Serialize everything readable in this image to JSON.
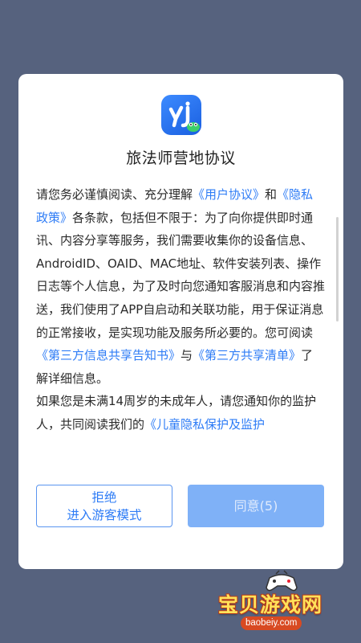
{
  "dialog": {
    "title": "旅法师营地协议",
    "paragraph1": [
      {
        "text": "请您务必谨慎阅读、充分理解",
        "link": false
      },
      {
        "text": "《用户协议》",
        "link": true
      },
      {
        "text": "和",
        "link": false
      },
      {
        "text": "《隐私政策》",
        "link": true
      },
      {
        "text": "各条款，包括但不限于：为了向你提供即时通讯、内容分享等服务，我们需要收集你的设备信息、AndroidID、OAID、MAC地址、软件安装列表、操作日志等个人信息，为了及时向您通知客服消息和内容推送，我们使用了APP自启动和关联功能，用于保证消息的正常接收，是实现功能及服务所必要的。您可阅读",
        "link": false
      },
      {
        "text": "《第三方信息共享告知书》",
        "link": true
      },
      {
        "text": "与",
        "link": false
      },
      {
        "text": "《第三方共享清单》",
        "link": true
      },
      {
        "text": "了解详细信息。",
        "link": false
      }
    ],
    "paragraph2": [
      {
        "text": "如果您是未满14周岁的未成年人，请您通知你的监护人，共同阅读我们的",
        "link": false
      },
      {
        "text": "《儿童隐私保护及监护",
        "link": true
      }
    ],
    "decline_line1": "拒绝",
    "decline_line2": "进入游客模式",
    "agree_label": "同意(5)"
  },
  "watermark": {
    "text": "宝贝游戏网",
    "url": "baobeiy.com"
  },
  "colors": {
    "background": "#56627e",
    "link": "#2e7cf6",
    "agree_button": "#7fb1f7"
  },
  "icons": {
    "app_logo": "yj-app-logo-icon",
    "mascot": "gamepad-mascot-icon"
  }
}
